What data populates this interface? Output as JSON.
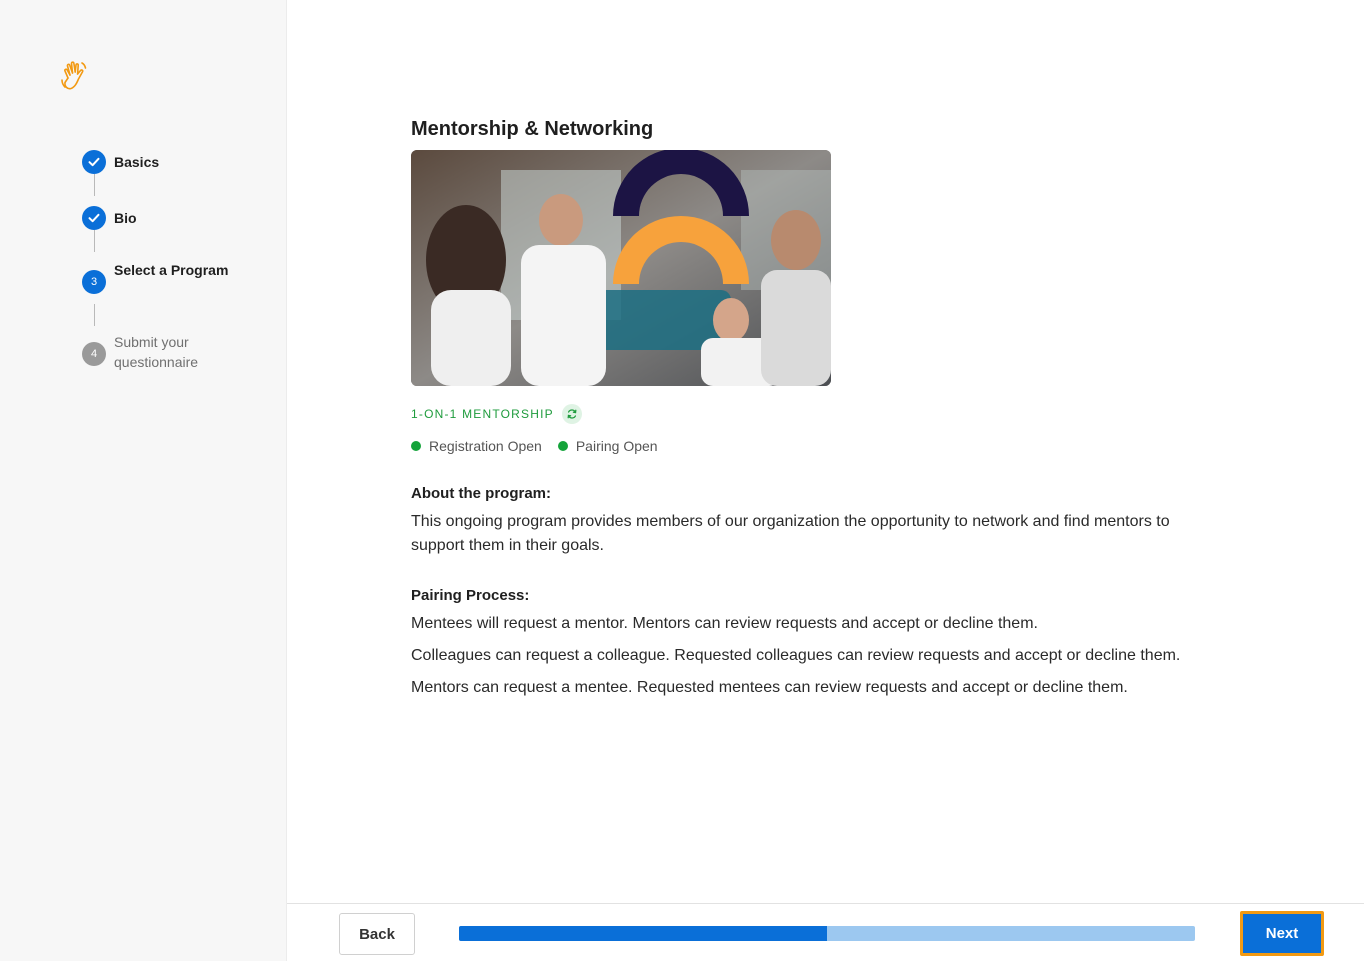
{
  "sidebar": {
    "logo_icon": "waving-hand-icon",
    "steps": [
      {
        "label": "Basics",
        "status": "done",
        "marker": ""
      },
      {
        "label": "Bio",
        "status": "done",
        "marker": ""
      },
      {
        "label": "Select a Program",
        "status": "current",
        "marker": "3"
      },
      {
        "label": "Submit your questionnaire",
        "status": "pending",
        "marker": "4"
      }
    ]
  },
  "program": {
    "title": "Mentorship & Networking",
    "type_label": "1-ON-1 MENTORSHIP",
    "type_icon": "sync-icon",
    "statuses": [
      "Registration Open",
      "Pairing Open"
    ],
    "about_title": "About the program:",
    "about_text": "This ongoing program provides members of our organization the opportunity to network and find mentors to support them in their goals.",
    "pairing_title": "Pairing Process:",
    "pairing_lines": [
      "Mentees will request a mentor. Mentors can review requests and accept or decline them.",
      "Colleagues can request a colleague. Requested colleagues can review requests and accept or decline them.",
      "Mentors can request a mentee. Requested mentees can review requests and accept or decline them."
    ]
  },
  "footer": {
    "back_label": "Back",
    "next_label": "Next",
    "progress_fraction": 0.5
  },
  "colors": {
    "primary": "#0a6fd8",
    "success": "#14a33a",
    "focus_outline": "#f29a13",
    "logo": "#f29a13"
  }
}
